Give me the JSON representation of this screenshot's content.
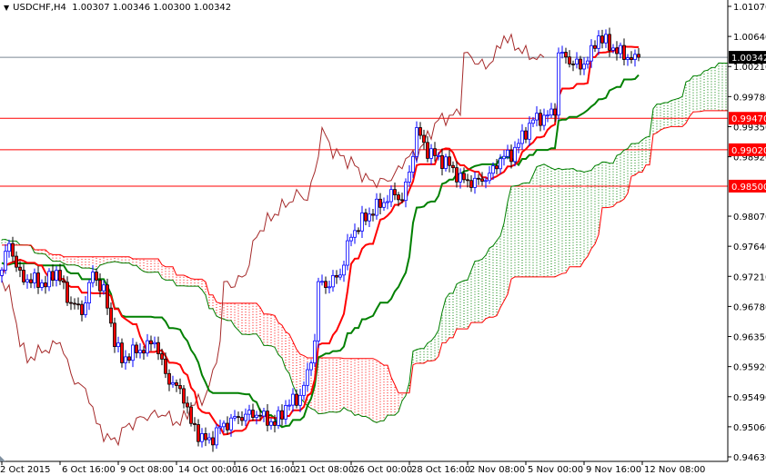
{
  "header": {
    "symbol": "USDCHF,H4",
    "ohlc": "1.00307 1.00346 1.00300 1.00342"
  },
  "chart_data": {
    "type": "candlestick",
    "title": "USDCHF,H4",
    "indicator": "Ichimoku Kinko Hyo (9, 26, 52)",
    "ylim": [
      0.9463,
      1.0107
    ],
    "y_ticks": [
      "1.01070",
      "1.00640",
      "1.00210",
      "0.99780",
      "0.99350",
      "0.98920",
      "0.98070",
      "0.97640",
      "0.97210",
      "0.96780",
      "0.96350",
      "0.95920",
      "0.95490",
      "0.95060",
      "0.94630"
    ],
    "x_labels": [
      {
        "bar": 0,
        "label": "2 Oct 2015"
      },
      {
        "bar": 16,
        "label": "6 Oct 16:00"
      },
      {
        "bar": 32,
        "label": "9 Oct 08:00"
      },
      {
        "bar": 48,
        "label": "14 Oct 00:00"
      },
      {
        "bar": 64,
        "label": "16 Oct 16:00"
      },
      {
        "bar": 80,
        "label": "21 Oct 08:00"
      },
      {
        "bar": 96,
        "label": "26 Oct 00:00"
      },
      {
        "bar": 112,
        "label": "28 Oct 16:00"
      },
      {
        "bar": 128,
        "label": "2 Nov 08:00"
      },
      {
        "bar": 144,
        "label": "5 Nov 00:00"
      },
      {
        "bar": 160,
        "label": "9 Nov 16:00"
      },
      {
        "bar": 176,
        "label": "12 Nov 08:00"
      }
    ],
    "close_keypoints": [
      [
        -60,
        0.975
      ],
      [
        -30,
        0.978
      ],
      [
        -10,
        0.972
      ],
      [
        0,
        0.973
      ],
      [
        2,
        0.977
      ],
      [
        5,
        0.972
      ],
      [
        12,
        0.971
      ],
      [
        15,
        0.973
      ],
      [
        18,
        0.969
      ],
      [
        22,
        0.967
      ],
      [
        25,
        0.9725
      ],
      [
        28,
        0.97
      ],
      [
        31,
        0.963
      ],
      [
        33,
        0.96
      ],
      [
        35,
        0.961
      ],
      [
        40,
        0.962
      ],
      [
        42,
        0.963
      ],
      [
        45,
        0.958
      ],
      [
        50,
        0.955
      ],
      [
        52,
        0.951
      ],
      [
        55,
        0.949
      ],
      [
        57,
        0.9485
      ],
      [
        60,
        0.9505
      ],
      [
        65,
        0.952
      ],
      [
        70,
        0.9525
      ],
      [
        75,
        0.951
      ],
      [
        78,
        0.9535
      ],
      [
        82,
        0.955
      ],
      [
        84,
        0.958
      ],
      [
        86,
        0.963
      ],
      [
        87,
        0.971
      ],
      [
        90,
        0.971
      ],
      [
        93,
        0.9725
      ],
      [
        96,
        0.978
      ],
      [
        99,
        0.98
      ],
      [
        103,
        0.982
      ],
      [
        108,
        0.984
      ],
      [
        110,
        0.983
      ],
      [
        112,
        0.987
      ],
      [
        114,
        0.993
      ],
      [
        117,
        0.99
      ],
      [
        120,
        0.989
      ],
      [
        123,
        0.988
      ],
      [
        126,
        0.986
      ],
      [
        130,
        0.9855
      ],
      [
        134,
        0.9865
      ],
      [
        137,
        0.989
      ],
      [
        140,
        0.9895
      ],
      [
        143,
        0.992
      ],
      [
        146,
        0.9945
      ],
      [
        150,
        0.995
      ],
      [
        152,
        0.996
      ],
      [
        153,
        1.004
      ],
      [
        156,
        1.003
      ],
      [
        159,
        1.002
      ],
      [
        162,
        1.004
      ],
      [
        164,
        1.0065
      ],
      [
        166,
        1.0055
      ],
      [
        170,
        1.004
      ],
      [
        174,
        1.003
      ],
      [
        175,
        1.00342
      ]
    ],
    "horizontal_levels": [
      {
        "price": "0.99470",
        "color": "#ff0000"
      },
      {
        "price": "0.99020",
        "color": "#ff0000"
      },
      {
        "price": "0.98500",
        "color": "#ff0000"
      }
    ],
    "current_price": "1.00342",
    "colors": {
      "bull": "#0000ff",
      "bear_body": "#ff0000",
      "bear_wick": "#000000",
      "tenkan": "#ff0000",
      "kijun": "#008000",
      "chikou": "#a52a2a",
      "cloud_up": "#008000",
      "cloud_down": "#ff0000",
      "current": "#7a8694"
    }
  }
}
